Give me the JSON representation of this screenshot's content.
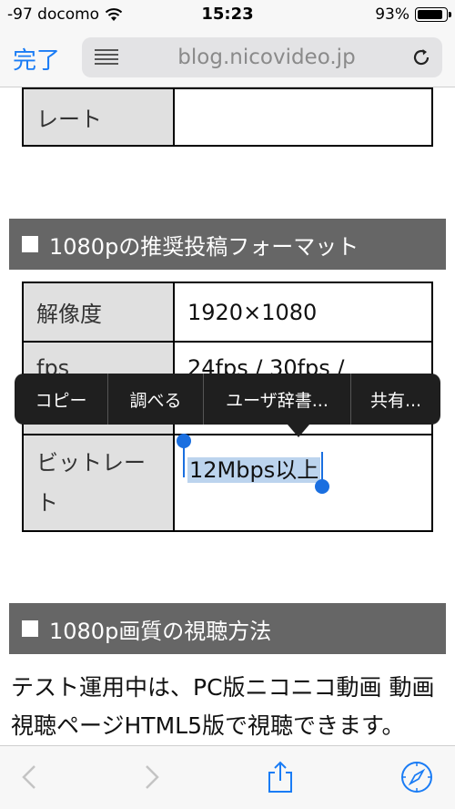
{
  "status_bar": {
    "carrier": "-97 docomo",
    "time": "15:23",
    "battery_percent": "93%",
    "battery_level": 0.93
  },
  "nav": {
    "done_label": "完了",
    "url": "blog.nicovideo.jp"
  },
  "content": {
    "prev_table_row_label": "レート",
    "section1_title": "1080pの推奨投稿フォーマット",
    "table": [
      {
        "key": "解像度",
        "value": "1920×1080"
      },
      {
        "key": "fps",
        "value": "24fps / 30fps /"
      },
      {
        "key": "ビットレート",
        "value": "12Mbps以上"
      }
    ],
    "section2_title": "1080p画質の視聴方法",
    "paragraph": "テスト運用中は、PC版ニコニコ動画 動画視聴ページHTML5版で視聴できます。"
  },
  "edit_menu": {
    "items": [
      "コピー",
      "調べる",
      "ユーザ辞書...",
      "共有..."
    ]
  },
  "toolbar": {
    "icons": [
      "chevron-left-icon",
      "chevron-right-icon",
      "share-icon",
      "compass-icon"
    ]
  },
  "colors": {
    "accent": "#1a7cf5",
    "section_header_bg": "#666666",
    "selection_highlight": "#bcd4ee"
  }
}
